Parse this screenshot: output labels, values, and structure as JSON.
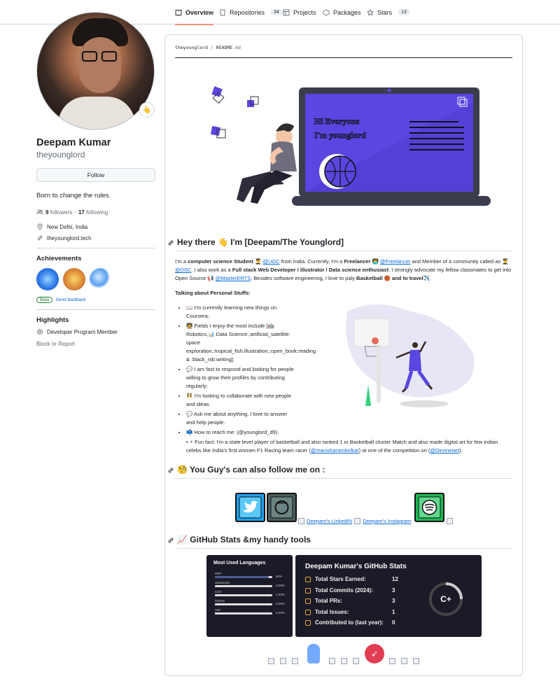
{
  "nav": {
    "tabs": [
      {
        "label": "Overview"
      },
      {
        "label": "Repositories",
        "count": "34"
      },
      {
        "label": "Projects"
      },
      {
        "label": "Packages"
      },
      {
        "label": "Stars",
        "count": "13"
      }
    ]
  },
  "profile": {
    "name": "Deepam Kumar",
    "login": "theyounglord",
    "follow_label": "Follow",
    "bio": "Born to change the rules.",
    "followers": "9",
    "followers_label": "followers",
    "following": "17",
    "following_label": "following",
    "location": "New Delhi, India",
    "website": "theyounglord.tech",
    "status_emoji": "👆"
  },
  "achievements": {
    "title": "Achievements",
    "beta": "Beta",
    "feedback": "Send feedback"
  },
  "highlights": {
    "title": "Highlights",
    "item": "Developer Program Member",
    "block": "Block or Report"
  },
  "readme": {
    "owner": "theyounglord",
    "file": "README",
    "ext": ".md",
    "hero_text_1": "Hi Everyone",
    "hero_text_2": "I'm younglord",
    "heading1": "Hey there 👋 I'm [Deepam/The Younglord]",
    "intro": {
      "a": "I'm a ",
      "b": "computer science Student",
      "c": " 👨‍🎓 ",
      "d": "@UGC",
      "e": " from India. Currently, I'm a ",
      "f": "Freelancer",
      "g": " 👨‍💻 ",
      "h": "@Freelancer",
      "i": " and Member of a community called as 👨‍🎓 ",
      "j": "@DSC",
      "k": ". I also work as a ",
      "l": "Full stack Web Developer / illustrator / Data science enthusiast",
      "m": ". I strongly advocate my fellow classmates to get into Open Source 📢 ",
      "n": "@MasterERTS",
      "o": ". Besides software engineering, I love to paly ",
      "p": "Basketball 🏀 and to travel✈️",
      "q": "."
    },
    "personal_title": "Talking about Personal Stuffs:",
    "list": [
      "📖 I'm currently learning new things on Coursera;",
      "🧑‍🏫 Fields I enjoy the most include [🤖 Robotics,📊 Data Science,:artificial_satellite: space exploration,:tropical_fish:illustration,:open_book:reading & :black_nib:writing];",
      "💬 I am fast to respond and looking for people willing to grow their profiles by contributing regularly;",
      "👯 I'm looking to collaborate with new people and ideas.",
      "💬 Ask me about anything, I love to answer and help people.",
      "📫 How to reach me: (@younglord_d9)."
    ],
    "funfact_a": "⚡ Fun fact: I'm a state level player of basketball and also ranked 1 in Basketball cluster Match and also made digital art for few indian celebs like India's first women F1 Racing team racer (",
    "funfact_link1": "@manisharamkelkar",
    "funfact_b": ") at one of the competition on (",
    "funfact_link2": "@Devinetart",
    "funfact_c": ").",
    "heading2": "🧐 You Guy's can also follow me on :",
    "linkedin_alt": "Deepam's LinkedIN",
    "instagram_alt": "Deepam's Instagram",
    "heading3": "📈 GitHub Stats &my handy tools"
  },
  "languages_card": {
    "title": "Most Used Languages",
    "items": [
      {
        "name": "PHP",
        "pct": "94%",
        "value": 94
      },
      {
        "name": "JavaScript",
        "pct": "4.28%",
        "value": 4.28
      },
      {
        "name": "CSS",
        "pct": "1.23%",
        "value": 1.23
      },
      {
        "name": "Python",
        "pct": "0.26%",
        "value": 0.26
      },
      {
        "name": "Vue",
        "pct": "0.22%",
        "value": 0.22
      }
    ]
  },
  "stats_card": {
    "title": "Deepam Kumar's GitHub Stats",
    "rows": [
      {
        "label": "Total Stars Earned:",
        "value": "12"
      },
      {
        "label": "Total Commits (2024):",
        "value": "3"
      },
      {
        "label": "Total PRs:",
        "value": "3"
      },
      {
        "label": "Total Issues:",
        "value": "1"
      },
      {
        "label": "Contributed to (last year):",
        "value": "0"
      }
    ],
    "grade": "C+"
  },
  "colors": {
    "accent": "#0969da",
    "laptop_screen": "#5a46e0",
    "card_bg": "#1a1b27",
    "tab_underline": "#fd8c73"
  }
}
